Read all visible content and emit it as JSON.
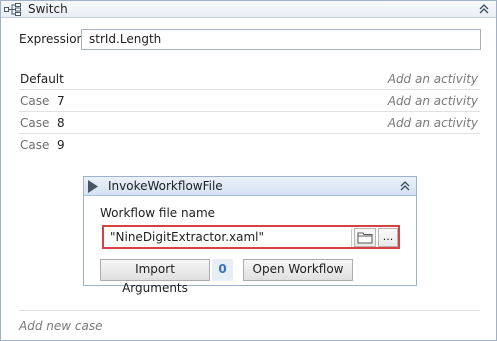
{
  "switch": {
    "title": "Switch",
    "expression_label": "Expression",
    "expression_value": "strId.Length",
    "default_label": "Default",
    "add_activity": "Add an activity",
    "case_word": "Case",
    "cases": [
      {
        "value": "7",
        "add_text": "Add an activity"
      },
      {
        "value": "8",
        "add_text": "Add an activity"
      },
      {
        "value": "9"
      }
    ],
    "add_new_case": "Add new case"
  },
  "invoke": {
    "title": "InvokeWorkflowFile",
    "file_label": "Workflow file name",
    "file_value": "\"NineDigitExtractor.xaml\"",
    "browse_dots": "...",
    "import_arguments": "Import Arguments",
    "arguments_count": "0",
    "open_workflow": "Open Workflow"
  },
  "icons": [
    "switch-icon",
    "collapse-icon",
    "play-icon",
    "folder-icon"
  ],
  "colors": {
    "accent": "#3a72b8",
    "error_border": "#d64242",
    "header_bg": "#d5e2f2"
  }
}
